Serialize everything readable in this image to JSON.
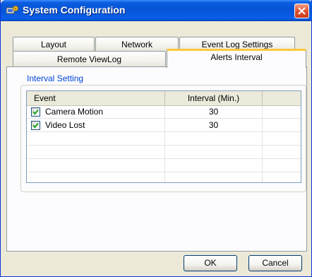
{
  "window": {
    "title": "System Configuration",
    "icon": "app-config-icon"
  },
  "tabs_back_row": [
    {
      "label": "Layout"
    },
    {
      "label": "Network"
    },
    {
      "label": "Event Log Settings"
    }
  ],
  "tabs_front_row": [
    {
      "label": "Remote ViewLog"
    },
    {
      "label": "Alerts Interval",
      "active": true
    }
  ],
  "group": {
    "title": "Interval Setting"
  },
  "grid": {
    "columns": [
      "Event",
      "Interval (Min.)"
    ],
    "rows": [
      {
        "checked": true,
        "event": "Camera Motion",
        "interval": "30"
      },
      {
        "checked": true,
        "event": "Video Lost",
        "interval": "30"
      }
    ]
  },
  "buttons": {
    "ok": "OK",
    "cancel": "Cancel"
  },
  "colors": {
    "accent": "#0046d5",
    "active_tab_highlight": "#ffc83c",
    "titlebar": "#0654d6",
    "check": "#21a121"
  }
}
